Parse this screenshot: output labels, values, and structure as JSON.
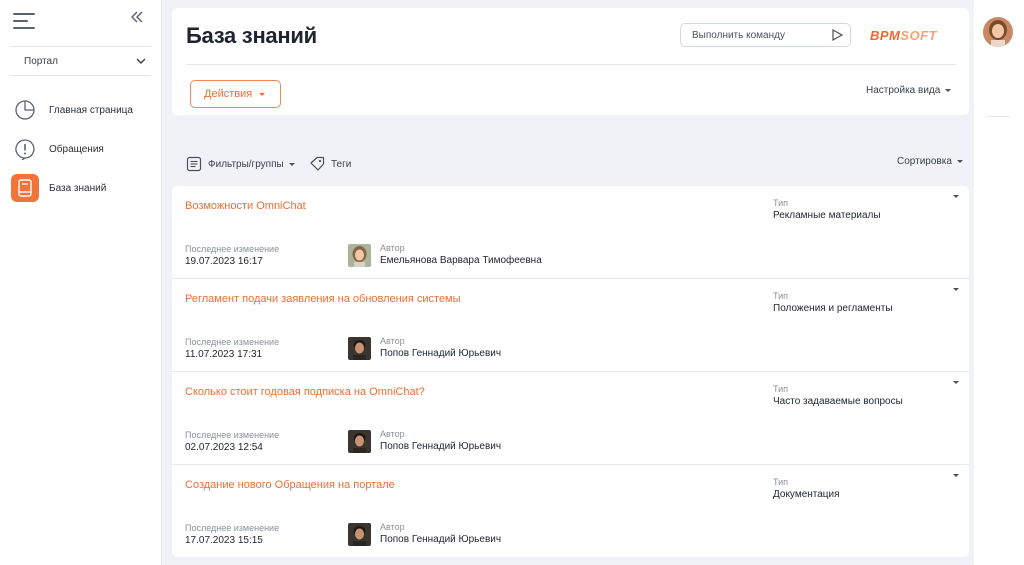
{
  "sidebar": {
    "portal_select": "Портал",
    "items": [
      {
        "label": "Главная страница",
        "icon": "pie-chart-icon"
      },
      {
        "label": "Обращения",
        "icon": "alert-icon"
      },
      {
        "label": "База знаний",
        "icon": "book-icon",
        "active": true
      }
    ]
  },
  "header": {
    "title": "База знаний",
    "command_placeholder": "Выполнить команду",
    "logo_main": "BPM",
    "logo_soft": "SOFT",
    "actions_label": "Действия",
    "view_settings_label": "Настройка вида"
  },
  "filterbar": {
    "filters_label": "Фильтры/группы",
    "tags_label": "Теги",
    "sort_label": "Сортировка"
  },
  "list": {
    "modified_label": "Последнее изменение",
    "author_label": "Автор",
    "type_label": "Тип",
    "rows": [
      {
        "title": "Возможности OmniChat",
        "modified": "19.07.2023 16:17",
        "author": "Емельянова Варвара Тимофеевна",
        "type": "Рекламные материалы",
        "avatar": "female"
      },
      {
        "title": "Регламент подачи заявления на обновления системы",
        "modified": "11.07.2023 17:31",
        "author": "Попов Геннадий Юрьевич",
        "type": "Положения и регламенты",
        "avatar": "male"
      },
      {
        "title": "Сколько стоит годовая подписка на OmniChat?",
        "modified": "02.07.2023 12:54",
        "author": "Попов Геннадий Юрьевич",
        "type": "Часто задаваемые вопросы",
        "avatar": "male"
      },
      {
        "title": "Создание нового Обращения на портале",
        "modified": "17.07.2023 15:15",
        "author": "Попов Геннадий Юрьевич",
        "type": "Документация",
        "avatar": "male"
      }
    ]
  },
  "colors": {
    "accent": "#ee6e33",
    "active_nav_bg": "#f3743a",
    "background": "#f0f2f7"
  }
}
